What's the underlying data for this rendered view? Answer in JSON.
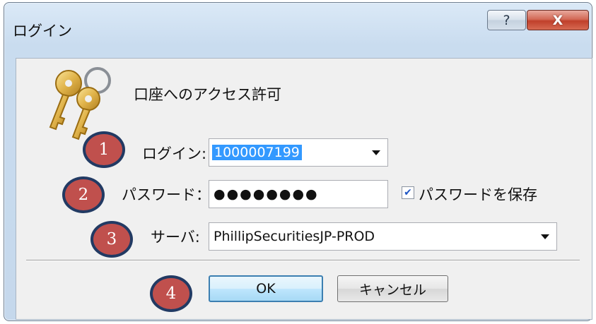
{
  "window": {
    "title": "ログイン",
    "help_glyph": "?",
    "close_glyph": "X"
  },
  "dialog": {
    "heading": "口座へのアクセス許可",
    "login_label": "ログイン:",
    "login_value": "1000007199",
    "password_label": "パスワード：",
    "password_value": "●●●●●●●●",
    "save_password_label": "パスワードを保存",
    "save_password_checked": true,
    "server_label": "サーバ:",
    "server_value": "PhillipSecuritiesJP-PROD",
    "ok_label": "OK",
    "cancel_label": "キャンセル"
  },
  "annotations": [
    "1",
    "2",
    "3",
    "4"
  ],
  "icons": {
    "keys": "keys-icon",
    "dropdown": "chevron-down-icon",
    "check": "checkmark-icon"
  },
  "colors": {
    "badge_fill": "#c0504d",
    "badge_border": "#223a63",
    "selection": "#3399ff",
    "close_button": "#c0402b"
  }
}
